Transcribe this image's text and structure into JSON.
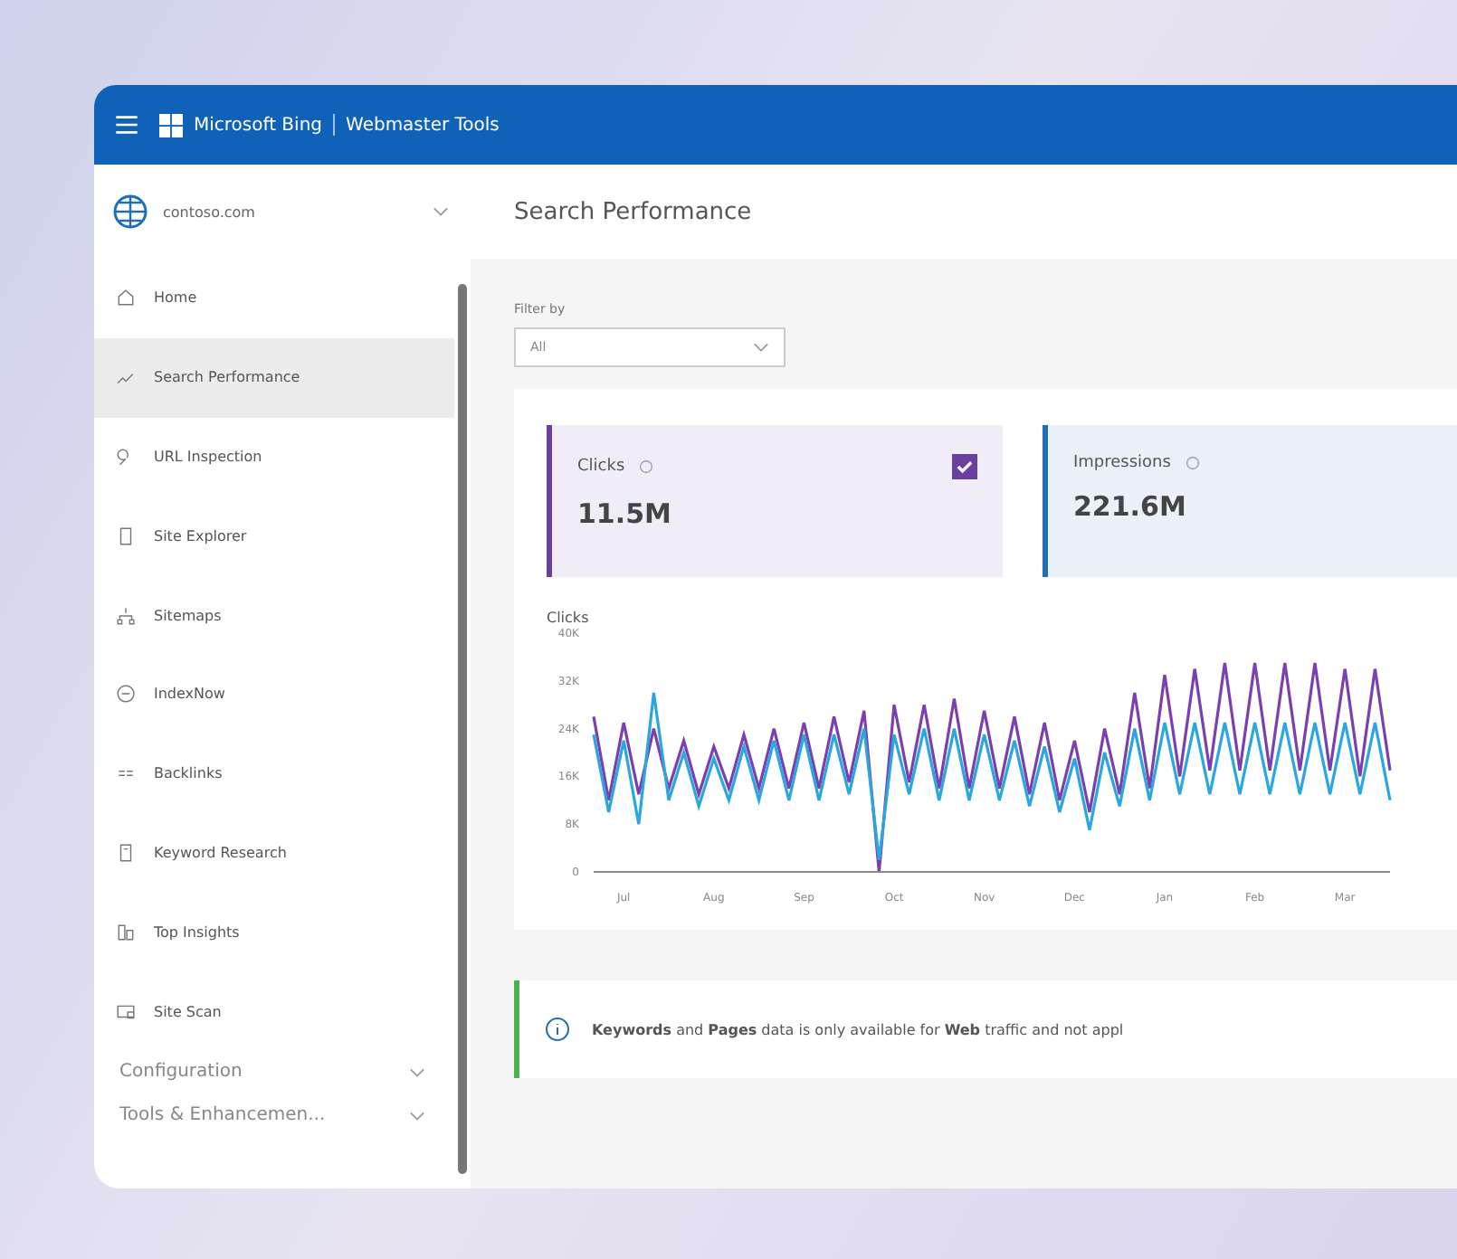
{
  "header": {
    "brand": "Microsoft Bing",
    "product": "Webmaster Tools"
  },
  "site_picker": {
    "value": "contoso.com"
  },
  "sidebar": {
    "items": [
      {
        "label": "Home",
        "selected": false
      },
      {
        "label": "Search Performance",
        "selected": true
      },
      {
        "label": "URL Inspection",
        "selected": false
      },
      {
        "label": "Site Explorer",
        "selected": false
      },
      {
        "label": "Sitemaps",
        "selected": false
      },
      {
        "label": "IndexNow",
        "selected": false
      },
      {
        "label": "Backlinks",
        "selected": false
      },
      {
        "label": "Keyword Research",
        "selected": false
      },
      {
        "label": "Top Insights",
        "selected": false
      },
      {
        "label": "Site Scan",
        "selected": false
      }
    ],
    "sections": [
      {
        "label": "Configuration",
        "expanded": false
      },
      {
        "label": "Tools & Enhancemen...",
        "expanded": false
      }
    ]
  },
  "page_title": "Search Performance",
  "filter": {
    "label": "Filter by",
    "value": "All"
  },
  "metrics": [
    {
      "label": "Clicks",
      "value": "11.5M",
      "color": "#6b3fa0",
      "checked": true
    },
    {
      "label": "Impressions",
      "value": "221.6M",
      "color": "#1f6fb5"
    }
  ],
  "chart": {
    "chart_data": {
      "type": "line",
      "title": "Clicks",
      "categories": [
        null,
        null,
        "Jul",
        null,
        null,
        null,
        null,
        null,
        "Aug",
        null,
        null,
        null,
        null,
        null,
        "Sep",
        null,
        null,
        null,
        null,
        null,
        "Oct",
        null,
        null,
        null,
        null,
        null,
        "Nov",
        null,
        null,
        null,
        null,
        null,
        "Dec",
        null,
        null,
        null,
        null,
        null,
        "Jan",
        null,
        null,
        null,
        null,
        null,
        "Feb",
        null,
        null,
        null,
        null,
        null,
        "Mar",
        null,
        null,
        null
      ],
      "yticks": [
        {
          "value": 0,
          "label": "0"
        },
        {
          "value": 8,
          "label": "8K"
        },
        {
          "value": 16,
          "label": "16K"
        },
        {
          "value": 24,
          "label": "24K"
        },
        {
          "value": 32,
          "label": "32K"
        },
        {
          "value": 40,
          "label": "40K"
        }
      ],
      "ylim": [
        0,
        40
      ],
      "series": [
        {
          "color": "#7b3fb0",
          "values": [
            26,
            12,
            25,
            13,
            24,
            14,
            22,
            13,
            21,
            14,
            23,
            14,
            24,
            14,
            25,
            14,
            26,
            15,
            27,
            0,
            28,
            15,
            28,
            14,
            29,
            14,
            27,
            14,
            26,
            13,
            25,
            12,
            22,
            10,
            24,
            13,
            30,
            14,
            33,
            16,
            34,
            17,
            35,
            17,
            35,
            17,
            35,
            17,
            35,
            17,
            34,
            16,
            34,
            17
          ]
        },
        {
          "color": "#2aa7e0",
          "values": [
            23,
            10,
            22,
            8,
            30,
            12,
            20,
            11,
            19,
            12,
            21,
            12,
            22,
            12,
            23,
            12,
            23,
            13,
            24,
            2,
            23,
            13,
            24,
            12,
            24,
            12,
            23,
            12,
            22,
            11,
            21,
            10,
            19,
            7,
            20,
            11,
            24,
            12,
            25,
            13,
            25,
            13,
            25,
            13,
            25,
            13,
            25,
            13,
            25,
            13,
            25,
            13,
            25,
            12
          ]
        }
      ]
    }
  },
  "notice": {
    "text": "**Keywords** and **Pages** data is only available for **Web** traffic and not appl"
  }
}
